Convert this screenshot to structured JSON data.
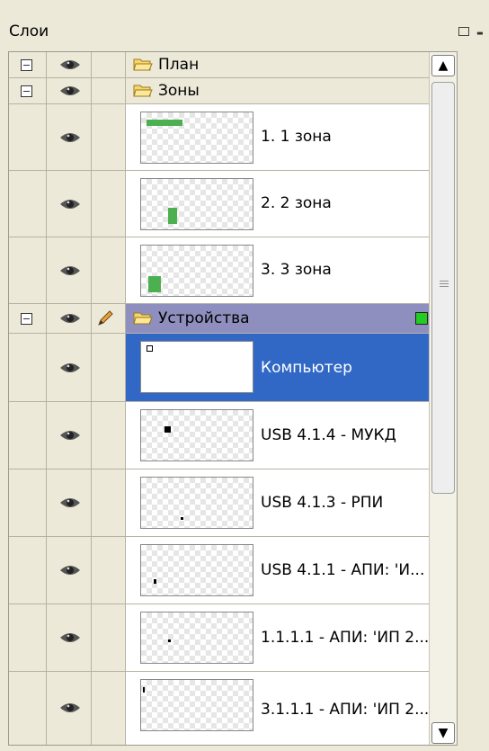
{
  "panel": {
    "title": "Слои"
  },
  "groups": [
    {
      "label": "План",
      "expanded": true
    },
    {
      "label": "Зоны",
      "expanded": true
    },
    {
      "label": "Устройства",
      "expanded": true,
      "selected": true,
      "status_color": "#22cc22"
    }
  ],
  "zone_items": [
    {
      "label": "1. 1 зона"
    },
    {
      "label": "2. 2 зона"
    },
    {
      "label": "3. 3 зона"
    }
  ],
  "device_items": [
    {
      "label": "Компьютер",
      "selected": true
    },
    {
      "label": "USB 4.1.4 - МУКД"
    },
    {
      "label": "USB 4.1.3 - РПИ"
    },
    {
      "label": "USB 4.1.1 - АПИ: 'И..."
    },
    {
      "label": "1.1.1.1 - АПИ: 'ИП 2..."
    },
    {
      "label": "3.1.1.1 - АПИ: 'ИП 2..."
    }
  ],
  "colors": {
    "selection": "#3168c6",
    "group_selected": "#8f8fbf",
    "zone_fill": "#4caf50"
  },
  "icons": {
    "visibility": "eye-icon",
    "lock": "pencil-icon",
    "folder": "folder-icon",
    "expander": "collapse-icon"
  }
}
